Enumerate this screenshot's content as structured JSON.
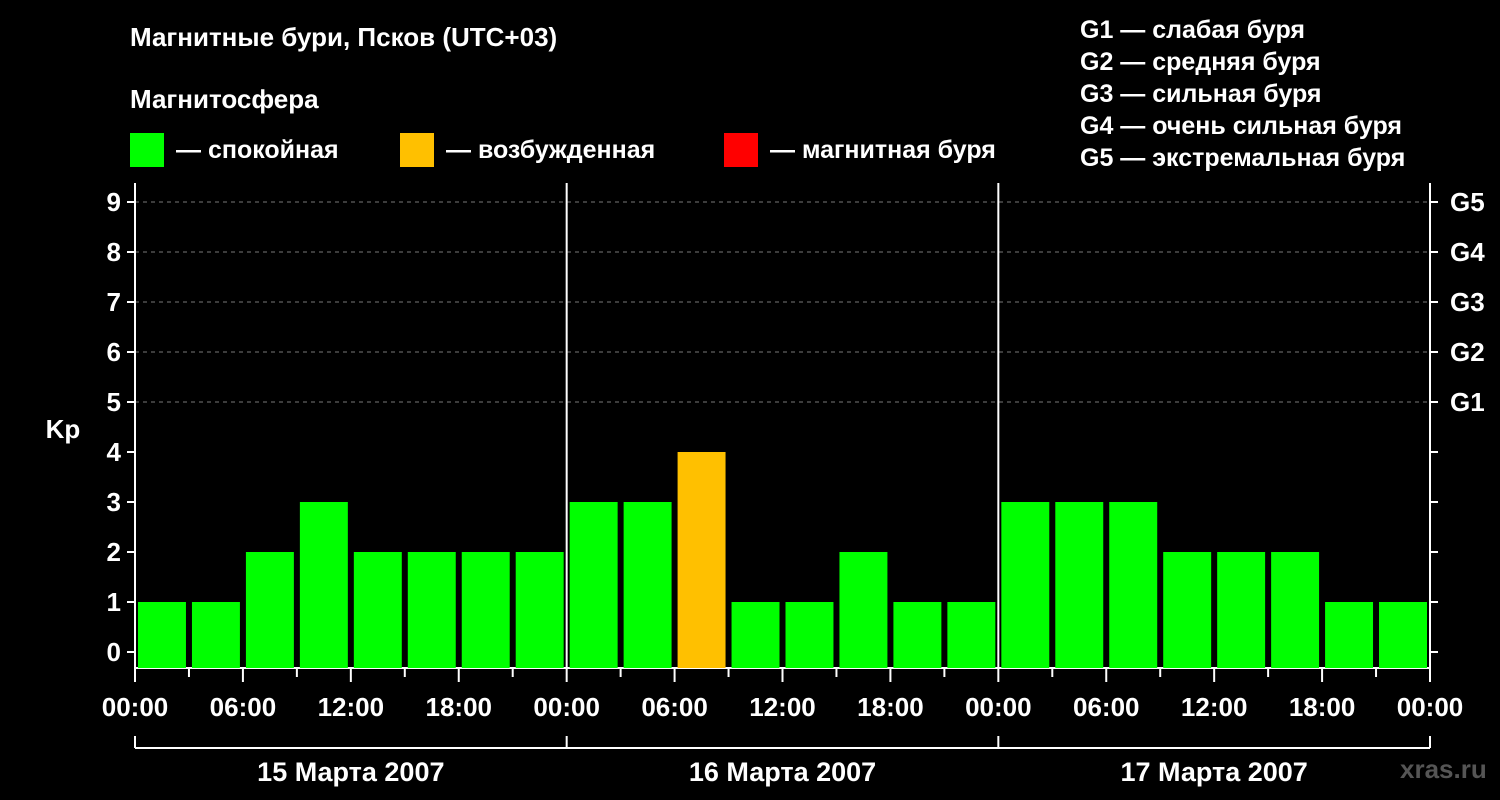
{
  "header": {
    "title": "Магнитные бури, Псков (UTC+03)",
    "subtitle": "Магнитосфера"
  },
  "legend": [
    {
      "color": "#00ff00",
      "label": "— спокойная"
    },
    {
      "color": "#ffc000",
      "label": "— возбужденная"
    },
    {
      "color": "#ff0000",
      "label": "— магнитная буря"
    }
  ],
  "g_legend": [
    "G1 — слабая буря",
    "G2 — средняя буря",
    "G3 — сильная буря",
    "G4 — очень сильная буря",
    "G5 — экстремальная буря"
  ],
  "watermark": "xras.ru",
  "chart_data": {
    "type": "bar",
    "ylabel": "Kp",
    "ylim": [
      0,
      9
    ],
    "y_ticks": [
      "0",
      "1",
      "2",
      "3",
      "4",
      "5",
      "6",
      "7",
      "8",
      "9"
    ],
    "right_ticks": [
      {
        "value": 5,
        "label": "G1"
      },
      {
        "value": 6,
        "label": "G2"
      },
      {
        "value": 7,
        "label": "G3"
      },
      {
        "value": 8,
        "label": "G4"
      },
      {
        "value": 9,
        "label": "G5"
      }
    ],
    "x_tick_labels": [
      "00:00",
      "06:00",
      "12:00",
      "18:00",
      "00:00",
      "06:00",
      "12:00",
      "18:00",
      "00:00",
      "06:00",
      "12:00",
      "18:00",
      "00:00"
    ],
    "days": [
      "15 Марта 2007",
      "16 Марта 2007",
      "17 Марта 2007"
    ],
    "interval_hours": 3,
    "values": [
      1,
      1,
      2,
      3,
      2,
      2,
      2,
      2,
      3,
      3,
      4,
      1,
      1,
      2,
      1,
      1,
      3,
      3,
      3,
      2,
      2,
      2,
      1,
      1
    ],
    "colors": {
      "quiet": "#00ff00",
      "active": "#ffc000",
      "storm": "#ff0000"
    },
    "grid": "dashed above Kp 5"
  }
}
